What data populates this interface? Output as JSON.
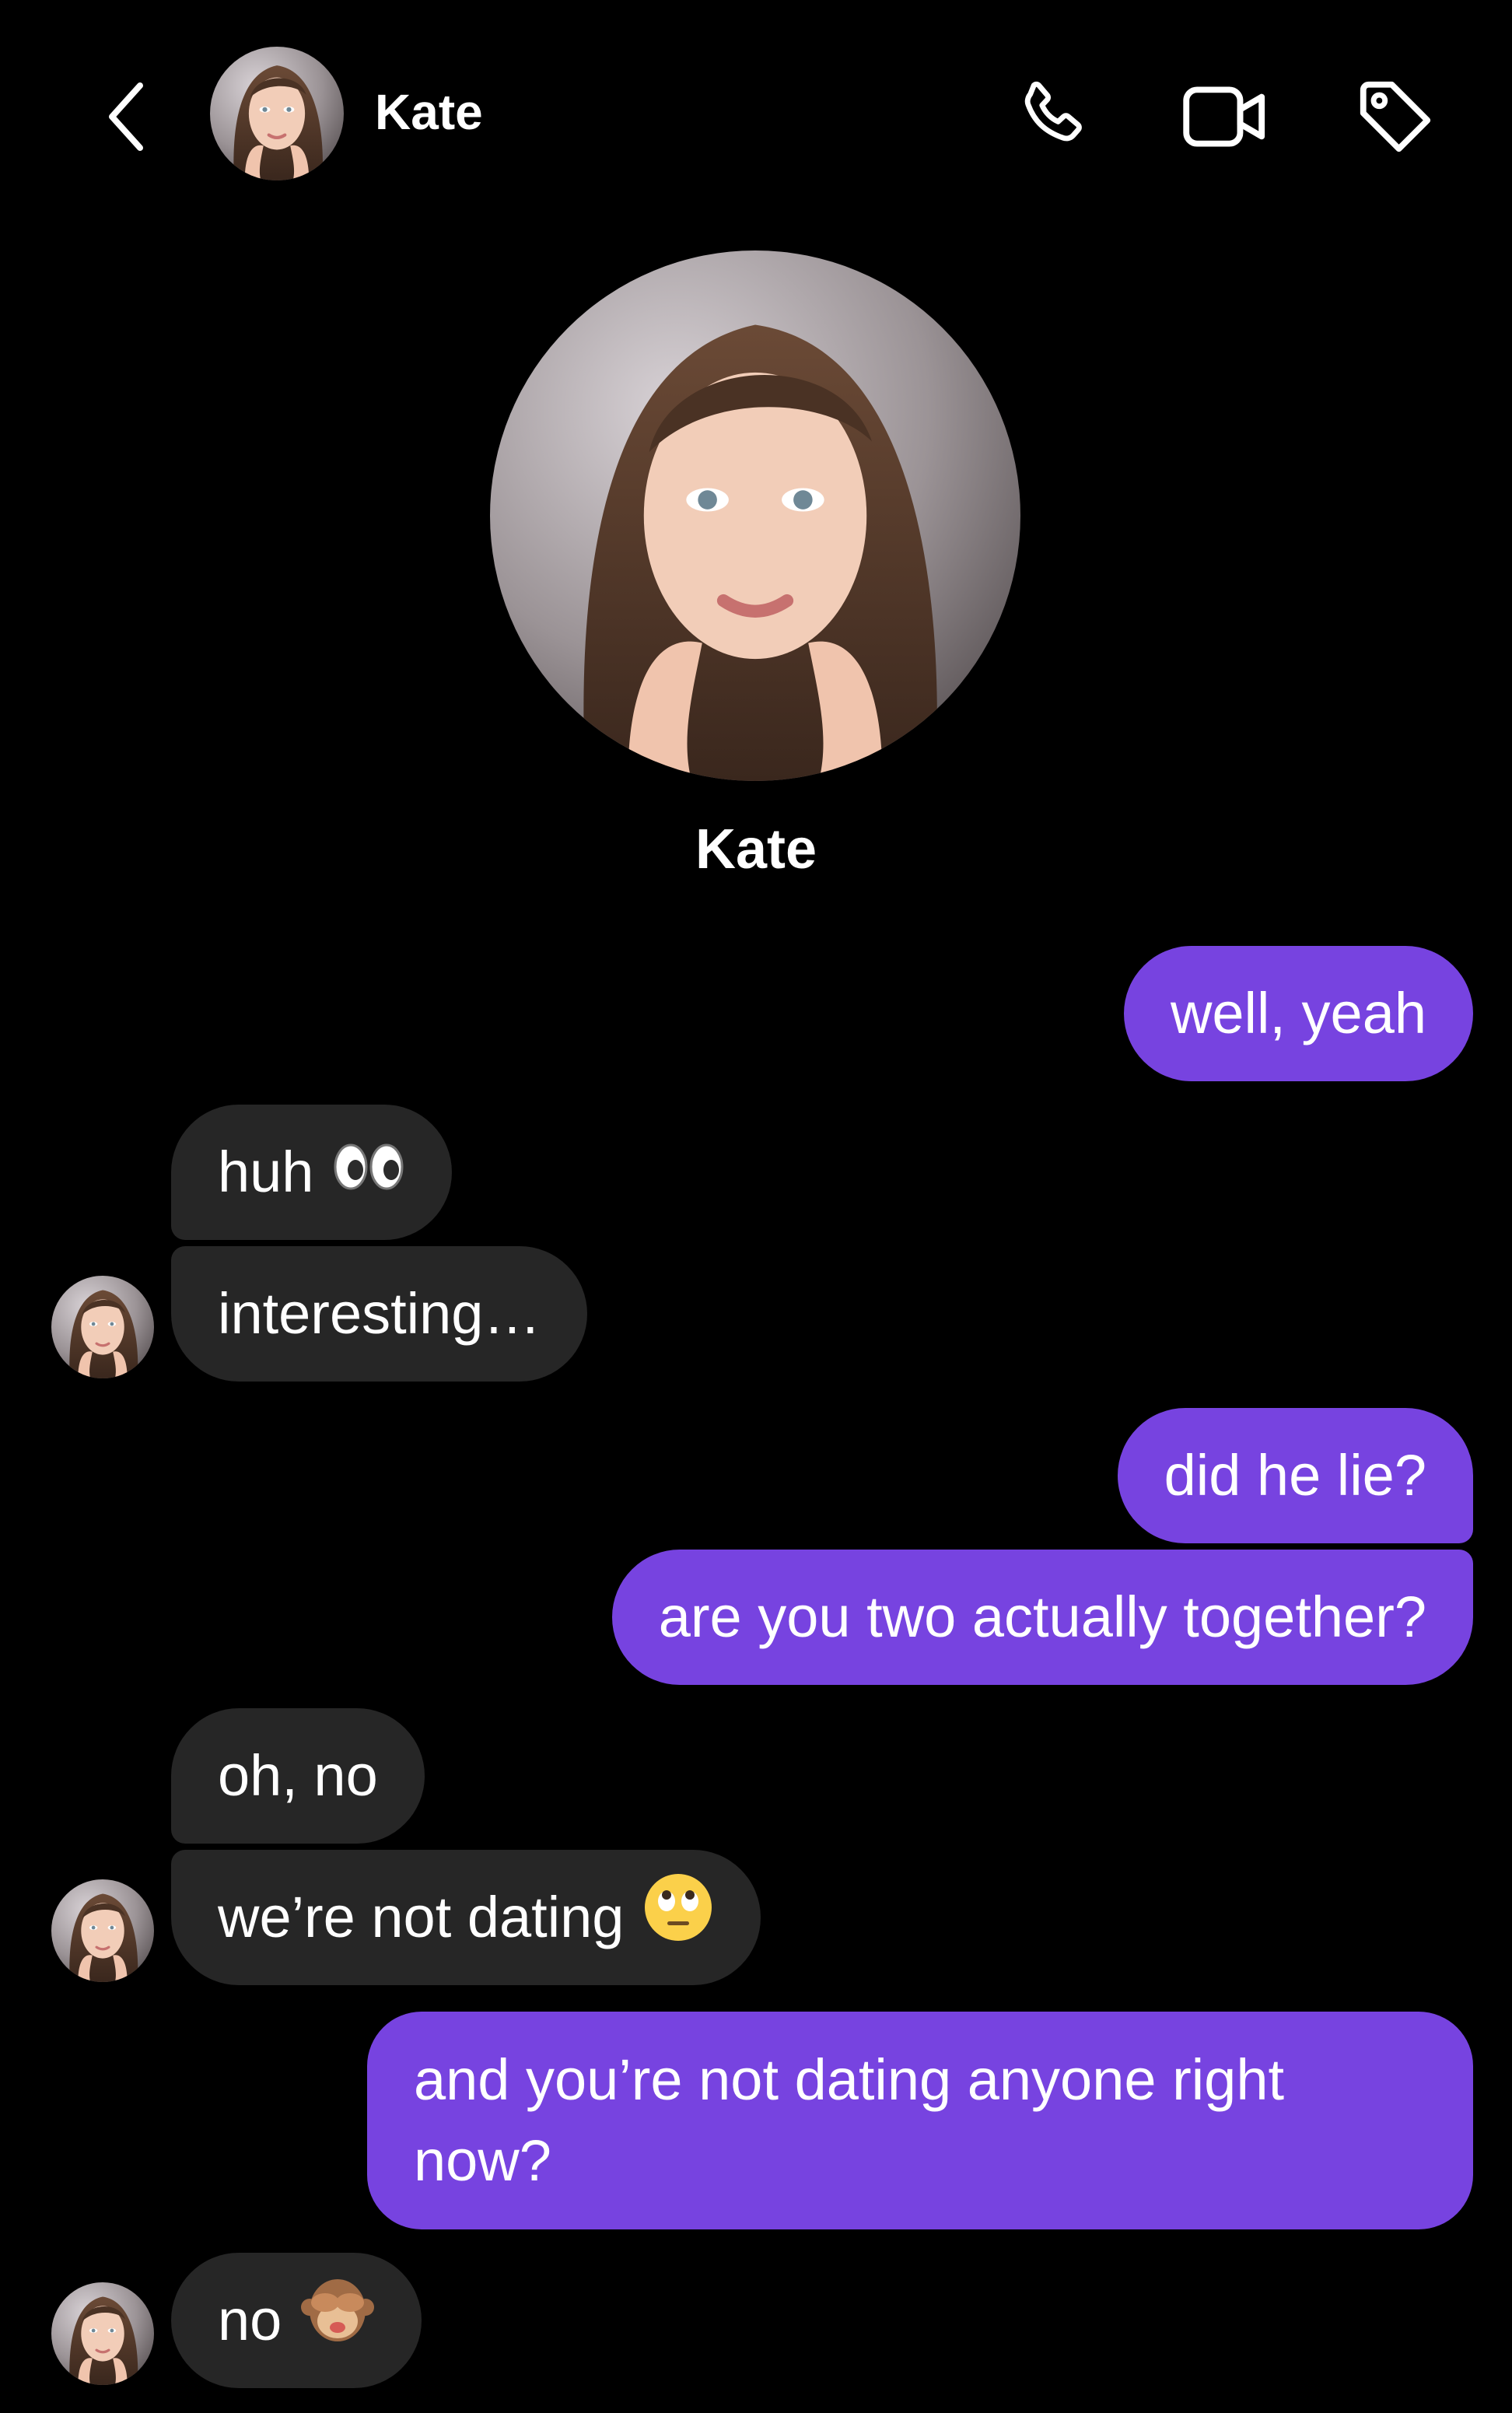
{
  "header": {
    "contact_name": "Kate",
    "icons": {
      "back": "chevron-left-icon",
      "call": "phone-icon",
      "video": "video-camera-icon",
      "tag": "tag-icon"
    }
  },
  "profile": {
    "name": "Kate"
  },
  "colors": {
    "background": "#000000",
    "outgoing_bubble": "#7743e0",
    "incoming_bubble": "#262626",
    "text": "#ffffff"
  },
  "messages": [
    {
      "direction": "outgoing",
      "text": "well, yeah"
    },
    {
      "direction": "incoming",
      "text": "huh",
      "emoji": "eyes-emoji"
    },
    {
      "direction": "incoming",
      "text": "interesting…"
    },
    {
      "direction": "outgoing",
      "text": "did he lie?"
    },
    {
      "direction": "outgoing",
      "text": "are you two actually together?"
    },
    {
      "direction": "incoming",
      "text": "oh, no"
    },
    {
      "direction": "incoming",
      "text": "we’re not dating",
      "emoji": "eye-roll-emoji"
    },
    {
      "direction": "outgoing",
      "text": "and you’re not dating anyone right now?"
    },
    {
      "direction": "incoming",
      "text": "no",
      "emoji": "see-no-evil-monkey-emoji"
    }
  ]
}
